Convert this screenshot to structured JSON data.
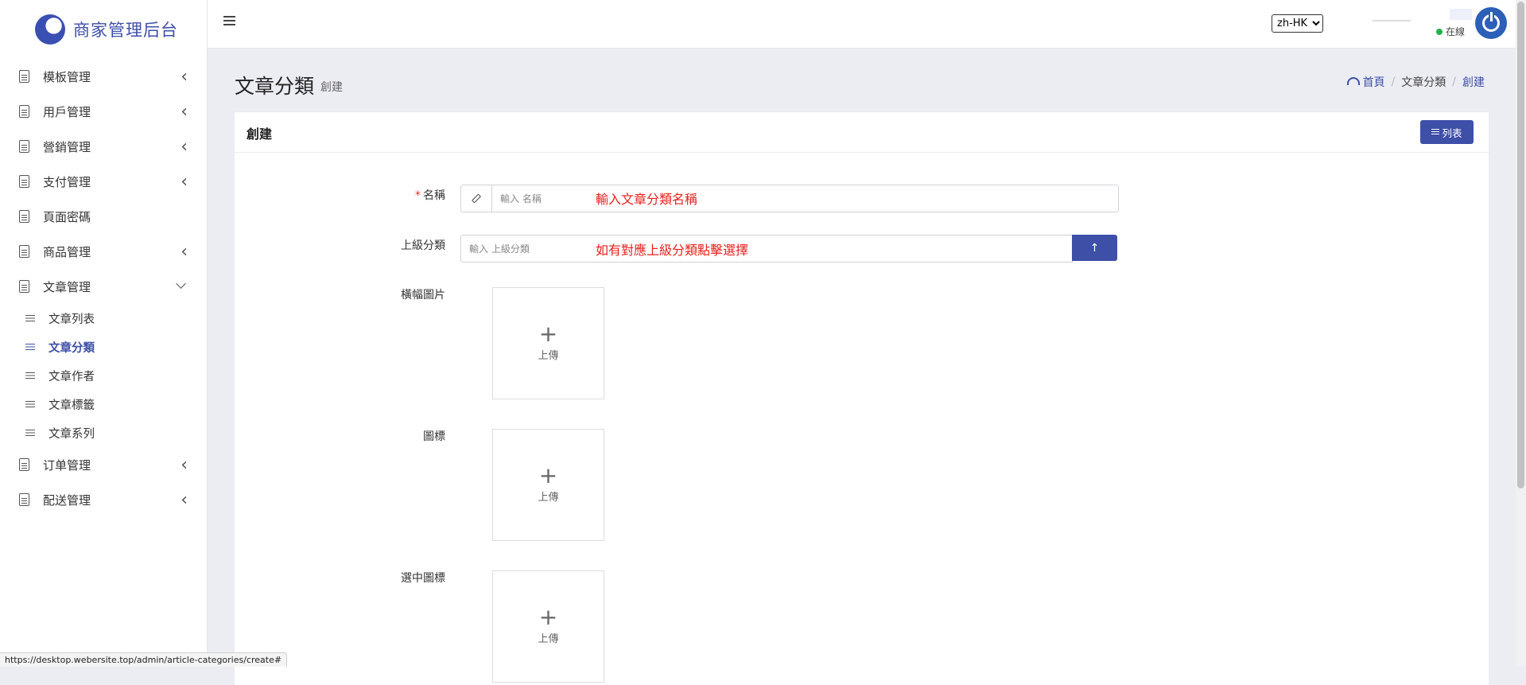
{
  "brand": {
    "title": "商家管理后台"
  },
  "sidebar": {
    "items": [
      {
        "label": "模板管理",
        "chevron": "left"
      },
      {
        "label": "用戶管理",
        "chevron": "left"
      },
      {
        "label": "營銷管理",
        "chevron": "left"
      },
      {
        "label": "支付管理",
        "chevron": "left"
      },
      {
        "label": "頁面密碼",
        "chevron": "none"
      },
      {
        "label": "商品管理",
        "chevron": "left"
      },
      {
        "label": "文章管理",
        "chevron": "down"
      }
    ],
    "submenu": [
      {
        "label": "文章列表"
      },
      {
        "label": "文章分類",
        "active": true
      },
      {
        "label": "文章作者"
      },
      {
        "label": "文章標籤"
      },
      {
        "label": "文章系列"
      }
    ],
    "items_after": [
      {
        "label": "订单管理",
        "chevron": "left"
      },
      {
        "label": "配送管理",
        "chevron": "left"
      }
    ]
  },
  "topbar": {
    "language": "zh-HK",
    "status_text": "在線"
  },
  "page": {
    "title": "文章分類",
    "subtitle": "創建"
  },
  "breadcrumb": {
    "home": "首頁",
    "section": "文章分類",
    "current": "創建"
  },
  "card": {
    "title": "創建",
    "list_button": "列表"
  },
  "form": {
    "name": {
      "label": "名稱",
      "placeholder": "輸入 名稱",
      "annotation": "輸入文章分類名稱"
    },
    "parent": {
      "label": "上級分類",
      "placeholder": "輸入 上級分類",
      "annotation": "如有對應上級分類點擊選擇"
    },
    "uploads": [
      {
        "label": "橫幅圖片",
        "button": "上傳"
      },
      {
        "label": "圖標",
        "button": "上傳"
      },
      {
        "label": "選中圖標",
        "button": "上傳"
      }
    ]
  },
  "status_bar": {
    "url": "https://desktop.webersite.top/admin/article-categories/create#"
  },
  "colors": {
    "primary": "#3e4fa8",
    "online": "#22b04a",
    "annotation": "#e8201c"
  }
}
